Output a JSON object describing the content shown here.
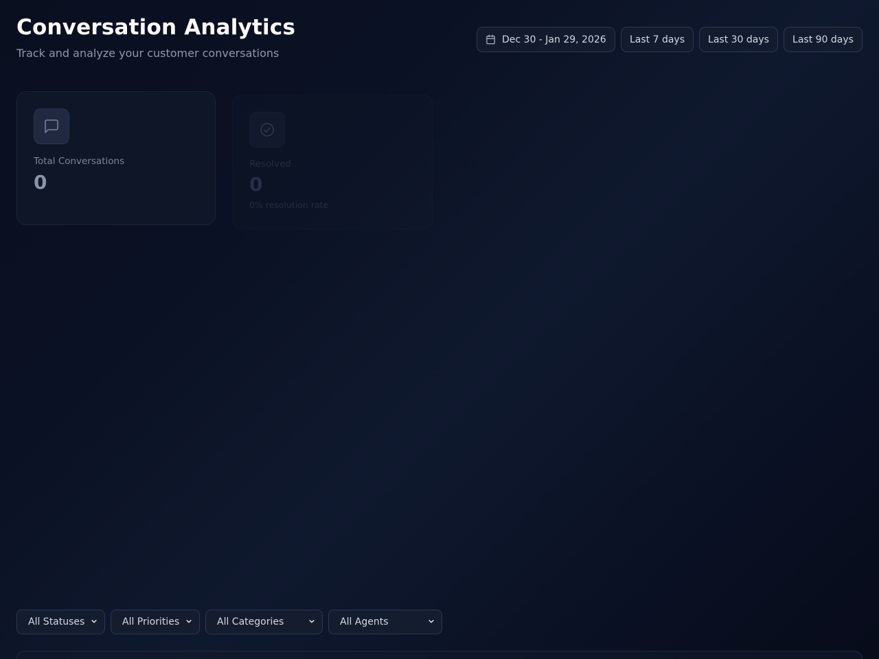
{
  "header": {
    "title": "Conversation Analytics",
    "subtitle": "Track and analyze your customer conversations"
  },
  "date_controls": {
    "range_label": "Dec 30 - Jan 29, 2026",
    "range_icon": "calendar-icon",
    "presets": [
      "Last 7 days",
      "Last 30 days",
      "Last 90 days"
    ]
  },
  "stats": [
    {
      "icon": "message-square-icon",
      "label": "Total Conversations",
      "value": "0"
    },
    {
      "icon": "check-circle-icon",
      "label": "Resolved",
      "value": "0",
      "sub": "0% resolution rate"
    }
  ],
  "filters": [
    {
      "selected": "All Statuses"
    },
    {
      "selected": "All Priorities"
    },
    {
      "selected": "All Categories"
    },
    {
      "selected": "All Agents"
    }
  ]
}
